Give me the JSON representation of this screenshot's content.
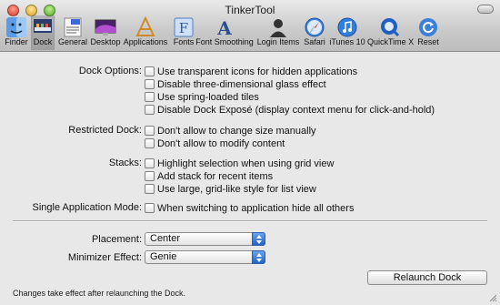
{
  "window": {
    "title": "TinkerTool"
  },
  "toolbar": {
    "items": [
      {
        "label": "Finder",
        "icon": "finder-icon"
      },
      {
        "label": "Dock",
        "icon": "dock-icon",
        "selected": true
      },
      {
        "label": "General",
        "icon": "general-icon"
      },
      {
        "label": "Desktop",
        "icon": "desktop-icon"
      },
      {
        "label": "Applications",
        "icon": "applications-icon"
      },
      {
        "label": "Fonts",
        "icon": "fonts-icon"
      },
      {
        "label": "Font Smoothing",
        "icon": "font-smoothing-icon"
      },
      {
        "label": "Login Items",
        "icon": "login-items-icon"
      },
      {
        "label": "Safari",
        "icon": "safari-icon"
      },
      {
        "label": "iTunes 10",
        "icon": "itunes-icon"
      },
      {
        "label": "QuickTime X",
        "icon": "quicktime-icon"
      },
      {
        "label": "Reset",
        "icon": "reset-icon"
      }
    ]
  },
  "dock_options": {
    "label": "Dock Options:",
    "items": [
      {
        "label": "Use transparent icons for hidden applications",
        "checked": false
      },
      {
        "label": "Disable three-dimensional glass effect",
        "checked": false
      },
      {
        "label": "Use spring-loaded tiles",
        "checked": false
      },
      {
        "label": "Disable Dock Exposé (display context menu for click-and-hold)",
        "checked": false
      }
    ]
  },
  "restricted_dock": {
    "label": "Restricted Dock:",
    "items": [
      {
        "label": "Don't allow to change size manually",
        "checked": false
      },
      {
        "label": "Don't allow to modify content",
        "checked": false
      }
    ]
  },
  "stacks": {
    "label": "Stacks:",
    "items": [
      {
        "label": "Highlight selection when using grid view",
        "checked": false
      },
      {
        "label": "Add stack for recent items",
        "checked": false
      },
      {
        "label": "Use large, grid-like style for list view",
        "checked": false
      }
    ]
  },
  "single_app_mode": {
    "label": "Single Application Mode:",
    "item": {
      "label": "When switching to application hide all others",
      "checked": false
    }
  },
  "placement": {
    "label": "Placement:",
    "value": "Center"
  },
  "minimizer_effect": {
    "label": "Minimizer Effect:",
    "value": "Genie"
  },
  "relaunch_button": "Relaunch Dock",
  "footer_note": "Changes take effect after relaunching the Dock.",
  "colors": {
    "window_bg": "#e8e8e8",
    "popup_arrow": "#2163c9"
  }
}
